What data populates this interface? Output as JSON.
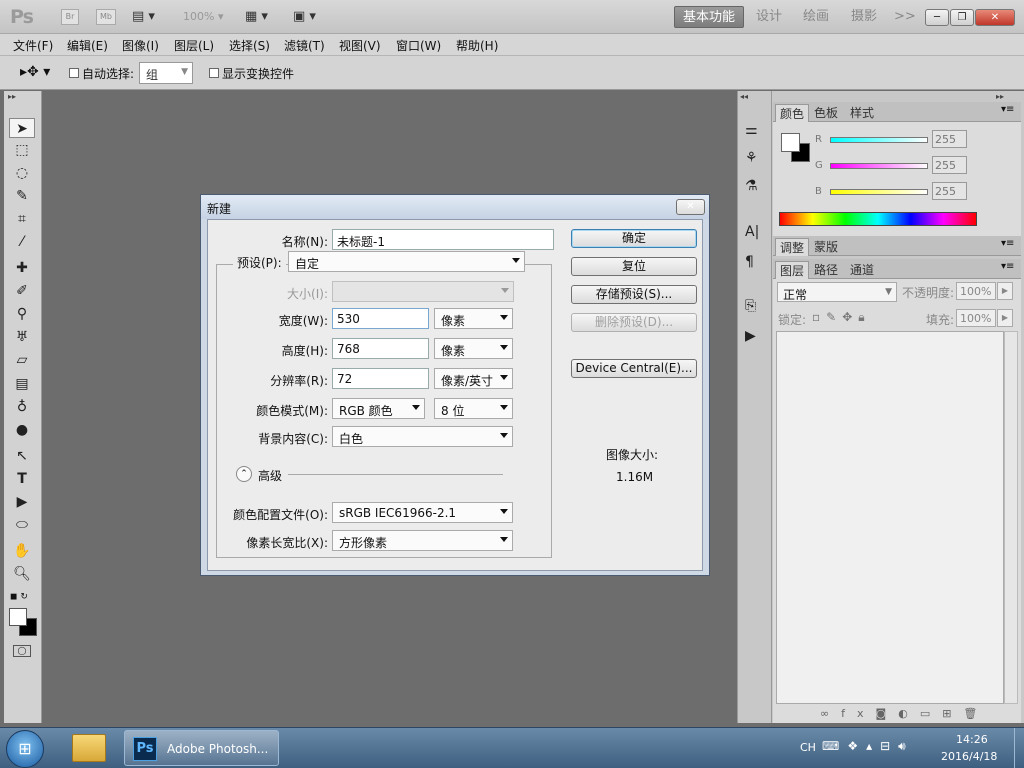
{
  "app": {
    "logo": "Ps",
    "bridge_label": "Br",
    "mini_bridge_label": "Mb",
    "zoom": "100%",
    "workspaces": [
      "基本功能",
      "设计",
      "绘画",
      "摄影"
    ],
    "more": ">>"
  },
  "menu": [
    "文件(F)",
    "编辑(E)",
    "图像(I)",
    "图层(L)",
    "选择(S)",
    "滤镜(T)",
    "视图(V)",
    "窗口(W)",
    "帮助(H)"
  ],
  "options": {
    "auto_select_label": "自动选择:",
    "auto_select_value": "组",
    "show_transform_label": "显示变换控件"
  },
  "right_panel": {
    "tabs_top": [
      "颜色",
      "色板",
      "样式"
    ],
    "r_label": "R",
    "g_label": "G",
    "b_label": "B",
    "r_value": "255",
    "g_value": "255",
    "b_value": "255",
    "tabs_mid": [
      "调整",
      "蒙版"
    ],
    "tabs_layers": [
      "图层",
      "路径",
      "通道"
    ],
    "blend_mode": "正常",
    "opacity_label": "不透明度:",
    "opacity_value": "100%",
    "lock_label": "锁定:",
    "fill_label": "填充:",
    "fill_value": "100%"
  },
  "dialog": {
    "title": "新建",
    "name_label": "名称(N):",
    "name_value": "未标题-1",
    "preset_label": "预设(P):",
    "preset_value": "自定",
    "size_label": "大小(I):",
    "width_label": "宽度(W):",
    "width_value": "530",
    "width_unit": "像素",
    "height_label": "高度(H):",
    "height_value": "768",
    "height_unit": "像素",
    "resolution_label": "分辨率(R):",
    "resolution_value": "72",
    "resolution_unit": "像素/英寸",
    "color_mode_label": "颜色模式(M):",
    "color_mode_value": "RGB 颜色",
    "bit_depth_value": "8 位",
    "bg_label": "背景内容(C):",
    "bg_value": "白色",
    "advanced_label": "高级",
    "profile_label": "颜色配置文件(O):",
    "profile_value": "sRGB IEC61966-2.1",
    "aspect_label": "像素长宽比(X):",
    "aspect_value": "方形像素",
    "ok_label": "确定",
    "reset_label": "复位",
    "save_preset_label": "存储预设(S)...",
    "delete_preset_label": "删除预设(D)...",
    "device_central_label": "Device Central(E)...",
    "image_size_label": "图像大小:",
    "image_size_value": "1.16M"
  },
  "taskbar": {
    "app_label": "Adobe Photosh...",
    "lang": "CH",
    "time": "14:26",
    "date": "2016/4/18"
  },
  "colors": {
    "accent": "#3c7fb1",
    "workspace_active": "#8a8a8a",
    "canvas_bg": "#6d6d6d"
  }
}
